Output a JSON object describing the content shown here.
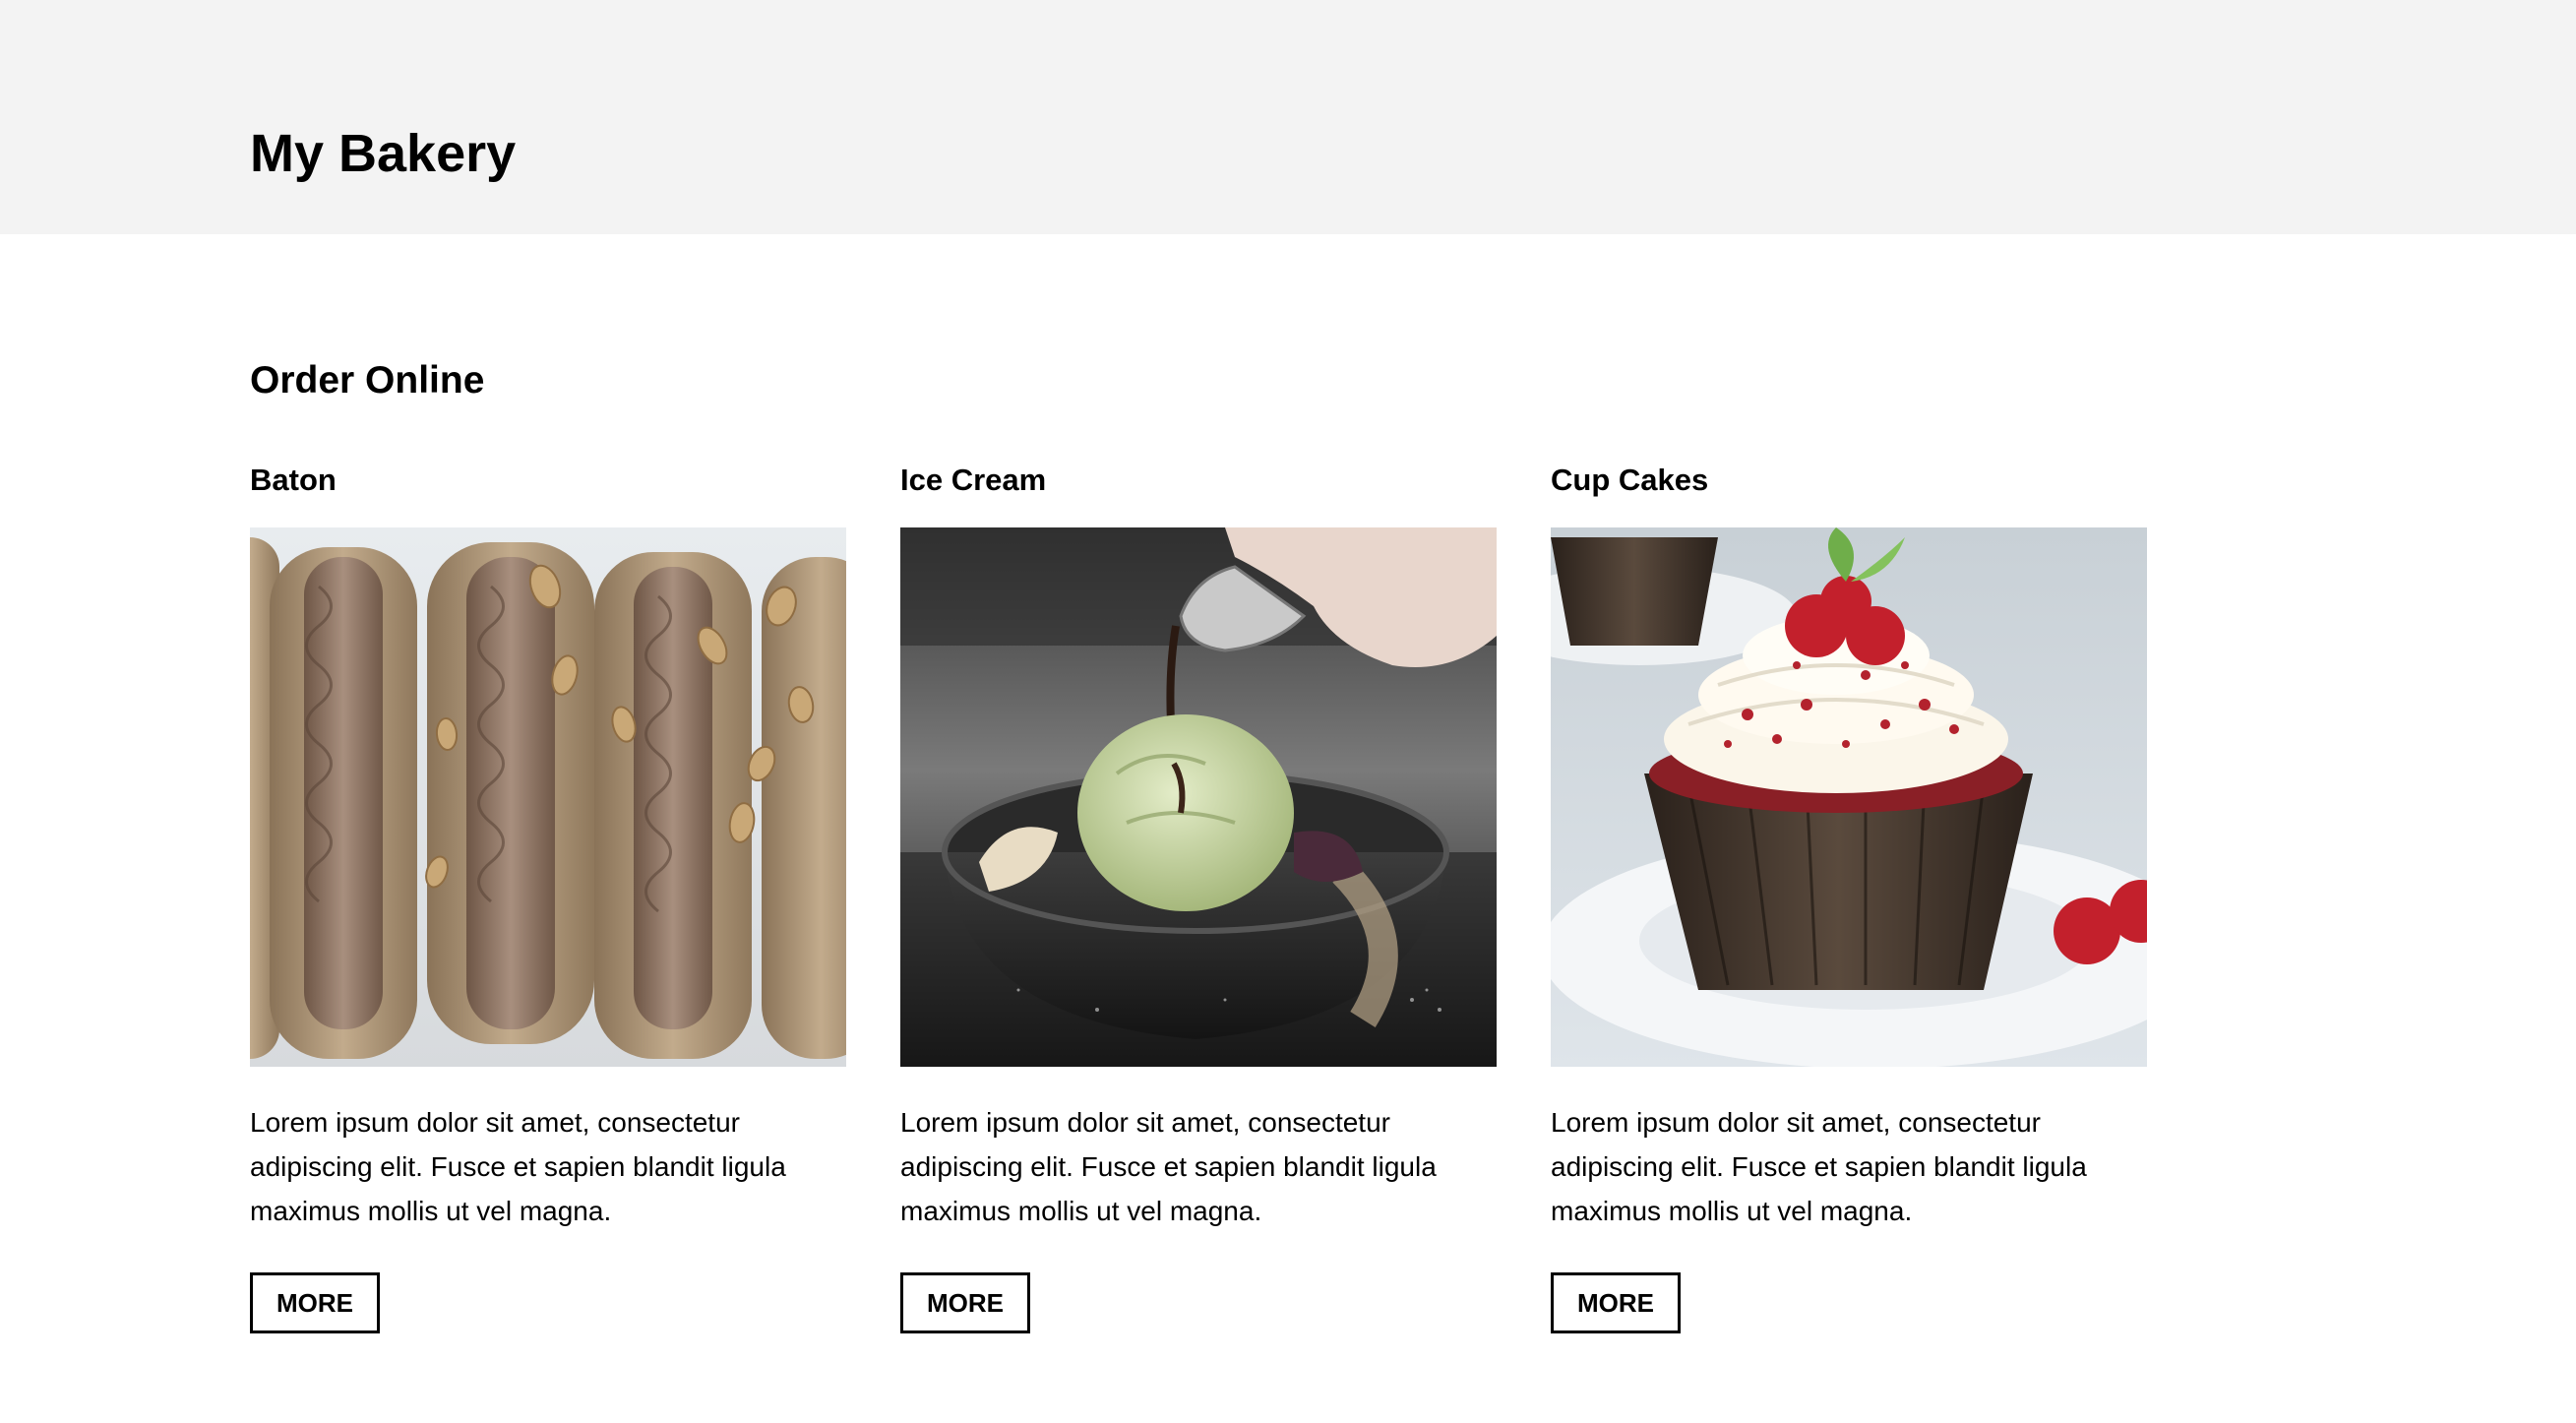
{
  "header": {
    "title": "My Bakery"
  },
  "main": {
    "section_title": "Order Online",
    "products": [
      {
        "name": "Baton",
        "image": "baton-pastries-photo",
        "description": "Lorem ipsum dolor sit amet, consectetur adipiscing elit. Fusce et sapien blandit ligula maximus mollis ut vel magna.",
        "button_label": "MORE"
      },
      {
        "name": "Ice Cream",
        "image": "ice-cream-bowl-photo",
        "description": "Lorem ipsum dolor sit amet, consectetur adipiscing elit. Fusce et sapien blandit ligula maximus mollis ut vel magna.",
        "button_label": "MORE"
      },
      {
        "name": "Cup Cakes",
        "image": "red-velvet-cupcake-photo",
        "description": "Lorem ipsum dolor sit amet, consectetur adipiscing elit. Fusce et sapien blandit ligula maximus mollis ut vel magna.",
        "button_label": "MORE"
      }
    ]
  },
  "colors": {
    "header_background": "#f3f3f3",
    "page_background": "#ffffff",
    "text": "#000000"
  }
}
